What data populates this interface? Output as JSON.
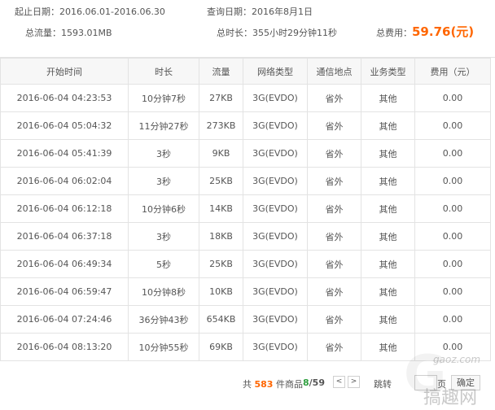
{
  "summary": {
    "start_date_label": "起止日期：",
    "start_date_value": "2016.06.01-2016.06.30",
    "query_date_label": "查询日期：",
    "query_date_value": "2016年8月1日",
    "total_traffic_label": "总流量：",
    "total_traffic_value": "1593.01MB",
    "total_duration_label": "总时长：",
    "total_duration_value": "355小时29分钟11秒",
    "total_fee_label": "总费用：",
    "total_fee_value": "59.76",
    "total_fee_unit": "(元)"
  },
  "table": {
    "headers": [
      "开始时间",
      "时长",
      "流量",
      "网络类型",
      "通信地点",
      "业务类型",
      "费用（元）"
    ],
    "rows": [
      [
        "2016-06-04 04:23:53",
        "10分钟7秒",
        "27KB",
        "3G(EVDO)",
        "省外",
        "其他",
        "0.00"
      ],
      [
        "2016-06-04 05:04:32",
        "11分钟27秒",
        "273KB",
        "3G(EVDO)",
        "省外",
        "其他",
        "0.00"
      ],
      [
        "2016-06-04 05:41:39",
        "3秒",
        "9KB",
        "3G(EVDO)",
        "省外",
        "其他",
        "0.00"
      ],
      [
        "2016-06-04 06:02:04",
        "3秒",
        "25KB",
        "3G(EVDO)",
        "省外",
        "其他",
        "0.00"
      ],
      [
        "2016-06-04 06:12:18",
        "10分钟6秒",
        "14KB",
        "3G(EVDO)",
        "省外",
        "其他",
        "0.00"
      ],
      [
        "2016-06-04 06:37:18",
        "3秒",
        "18KB",
        "3G(EVDO)",
        "省外",
        "其他",
        "0.00"
      ],
      [
        "2016-06-04 06:49:34",
        "5秒",
        "25KB",
        "3G(EVDO)",
        "省外",
        "其他",
        "0.00"
      ],
      [
        "2016-06-04 06:59:47",
        "10分钟8秒",
        "10KB",
        "3G(EVDO)",
        "省外",
        "其他",
        "0.00"
      ],
      [
        "2016-06-04 07:24:46",
        "36分钟43秒",
        "654KB",
        "3G(EVDO)",
        "省外",
        "其他",
        "0.00"
      ],
      [
        "2016-06-04 08:13:20",
        "10分钟55秒",
        "69KB",
        "3G(EVDO)",
        "省外",
        "其他",
        "0.00"
      ]
    ]
  },
  "pager": {
    "total_prefix": "共",
    "total_count": "583",
    "total_suffix": "件商品",
    "current_page": "8",
    "total_pages": "/59",
    "prev_label": "<",
    "next_label": ">",
    "jump_label": "跳转",
    "page_unit": "页",
    "go_label": "确定"
  },
  "watermark": {
    "site": "gaoz.com",
    "name": "搞趣网"
  },
  "colors": {
    "fee_orange": "#ff6600",
    "page_green": "#2e9e3e",
    "border": "#e3e3e3"
  }
}
